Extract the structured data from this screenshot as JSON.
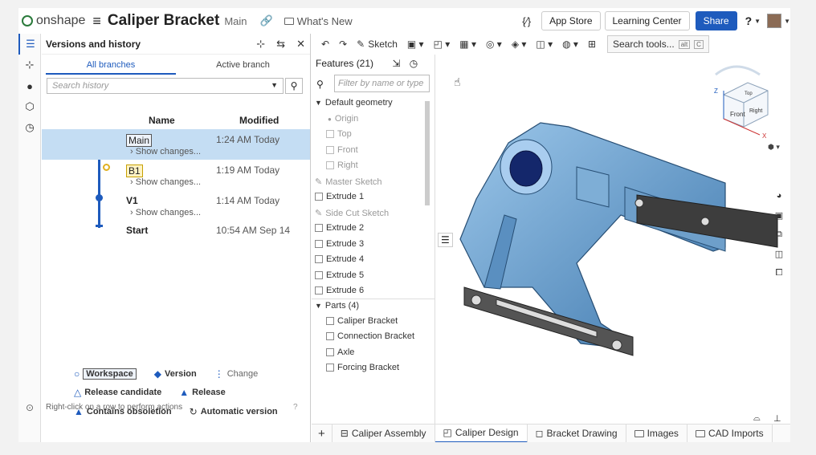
{
  "app": {
    "logo_text": "onshape",
    "doc_title": "Caliper Bracket",
    "branch": "Main",
    "whats_new": "What's New"
  },
  "header": {
    "app_store": "App Store",
    "learning_center": "Learning Center",
    "share": "Share",
    "variables": "{∕}"
  },
  "versions": {
    "title": "Versions and history",
    "tabs": [
      "All branches",
      "Active branch"
    ],
    "search_placeholder": "Search history",
    "col_name": "Name",
    "col_modified": "Modified",
    "rows": [
      {
        "name": "Main",
        "change": "Show changes...",
        "date": "1:24 AM Today"
      },
      {
        "name": "B1",
        "change": "Show changes...",
        "date": "1:19 AM Today"
      },
      {
        "name": "V1",
        "change": "Show changes...",
        "date": "1:14 AM Today"
      },
      {
        "name": "Start",
        "change": "",
        "date": "10:54 AM Sep 14"
      }
    ],
    "legend": {
      "workspace": "Workspace",
      "version": "Version",
      "change": "Change",
      "release_candidate": "Release candidate",
      "release": "Release",
      "obsoletion": "Contains obsoletion",
      "automatic": "Automatic version"
    },
    "status": "Right-click on a row to perform actions"
  },
  "toolbar": {
    "sketch": "Sketch",
    "search_tools": "Search tools...",
    "kbd_alt": "alt",
    "kbd_c": "C"
  },
  "features": {
    "header": "Features (21)",
    "filter_placeholder": "Filter by name or type",
    "default_geometry": "Default geometry",
    "items": [
      "Origin",
      "Top",
      "Front",
      "Right",
      "Master Sketch",
      "Extrude 1",
      "Side Cut Sketch",
      "Extrude 2",
      "Extrude 3",
      "Extrude 4",
      "Extrude 5",
      "Extrude 6"
    ],
    "parts_header": "Parts (4)",
    "parts": [
      "Caliper Bracket",
      "Connection Bracket",
      "Axle",
      "Forcing Bracket"
    ]
  },
  "viewcube": {
    "top": "Top",
    "front": "Front",
    "right": "Right",
    "x": "X",
    "z": "Z"
  },
  "bottom_tabs": [
    "Caliper Assembly",
    "Caliper Design",
    "Bracket Drawing",
    "Images",
    "CAD Imports"
  ],
  "colors": {
    "accent": "#1e5bbd",
    "selected_row": "#c4ddf3",
    "part": "#6fa8d6"
  }
}
